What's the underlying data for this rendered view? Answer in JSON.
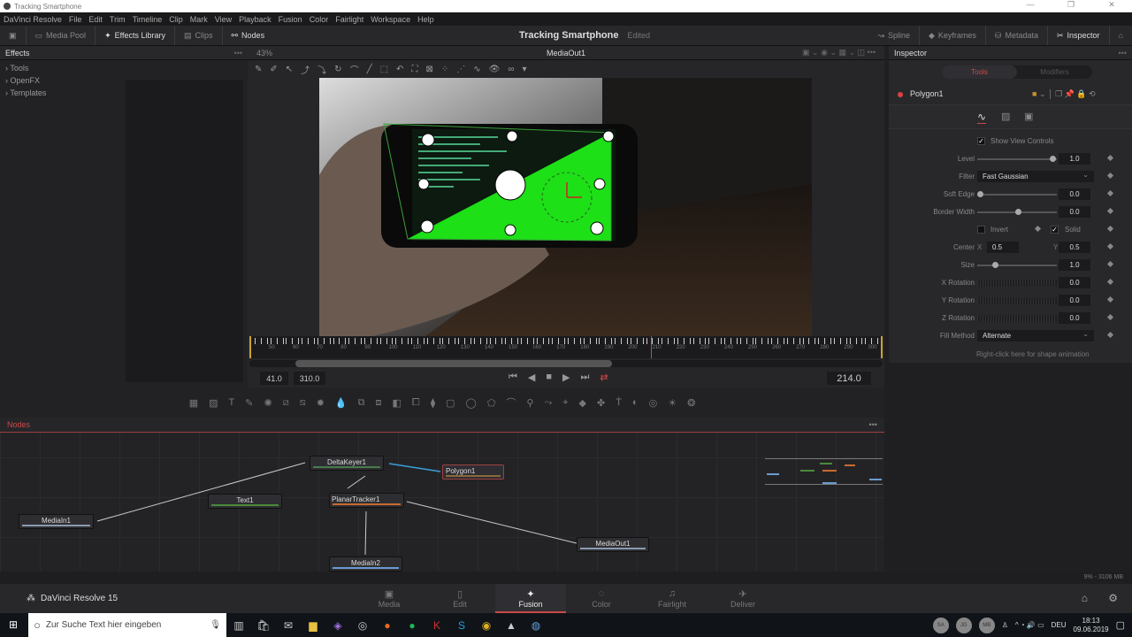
{
  "window": {
    "title": "Tracking Smartphone",
    "controls": [
      "—",
      "❐",
      "✕"
    ]
  },
  "menu": [
    "DaVinci Resolve",
    "File",
    "Edit",
    "Trim",
    "Timeline",
    "Clip",
    "Mark",
    "View",
    "Playback",
    "Fusion",
    "Color",
    "Fairlight",
    "Workspace",
    "Help"
  ],
  "toolbar": {
    "media_pool": "Media Pool",
    "effects_library": "Effects Library",
    "clips": "Clips",
    "nodes": "Nodes",
    "project": "Tracking Smartphone",
    "status": "Edited",
    "spline": "Spline",
    "keyframes": "Keyframes",
    "metadata": "Metadata",
    "inspector": "Inspector"
  },
  "effects": {
    "title": "Effects",
    "zoom": "43%",
    "items": [
      "Tools",
      "OpenFX",
      "Templates"
    ]
  },
  "viewer": {
    "title": "MediaOut1",
    "ruler_labels": [
      "50",
      "60",
      "70",
      "80",
      "90",
      "100",
      "110",
      "120",
      "130",
      "140",
      "150",
      "160",
      "170",
      "180",
      "190",
      "200",
      "210",
      "220",
      "230",
      "240",
      "250",
      "260",
      "270",
      "280",
      "290",
      "300"
    ],
    "start": "41.0",
    "end": "310.0",
    "current": "214.0"
  },
  "inspector": {
    "title": "Inspector",
    "tabs": [
      "Tools",
      "Modifiers"
    ],
    "node": "Polygon1",
    "show_view_controls": "Show View Controls",
    "level": {
      "label": "Level",
      "value": "1.0",
      "fraction": 0.95
    },
    "filter": {
      "label": "Filter",
      "value": "Fast Gaussian"
    },
    "soft_edge": {
      "label": "Soft Edge",
      "value": "0.0",
      "fraction": 0.0
    },
    "border_width": {
      "label": "Border Width",
      "value": "0.0",
      "fraction": 0.5
    },
    "invert": "Invert",
    "solid": "Solid",
    "center": {
      "label": "Center",
      "x_label": "X",
      "x": "0.5",
      "y_label": "Y",
      "y": "0.5"
    },
    "size": {
      "label": "Size",
      "value": "1.0",
      "fraction": 0.2
    },
    "x_rotation": {
      "label": "X Rotation",
      "value": "0.0"
    },
    "y_rotation": {
      "label": "Y Rotation",
      "value": "0.0"
    },
    "z_rotation": {
      "label": "Z Rotation",
      "value": "0.0"
    },
    "fill_method": {
      "label": "Fill Method",
      "value": "Alternate"
    },
    "hint": "Right-click here for shape animation"
  },
  "nodes": {
    "title": "Nodes",
    "items": {
      "deltakeyer": "DeltaKeyer1",
      "polygon": "Polygon1",
      "text": "Text1",
      "planar": "PlanarTracker1",
      "mediain1": "MediaIn1",
      "mediain2": "MediaIn2",
      "mediaout": "MediaOut1"
    }
  },
  "status": "9% - 3106 MB",
  "pagebar": {
    "brand": "DaVinci Resolve 15",
    "pages": [
      "Media",
      "Edit",
      "Fusion",
      "Color",
      "Fairlight",
      "Deliver"
    ],
    "active": "Fusion"
  },
  "taskbar": {
    "search_placeholder": "Zur Suche Text hier eingeben",
    "avatars": [
      "SA",
      "JG",
      "MB"
    ],
    "lang": "DEU",
    "time": "18:13",
    "date": "09.06.2019"
  }
}
